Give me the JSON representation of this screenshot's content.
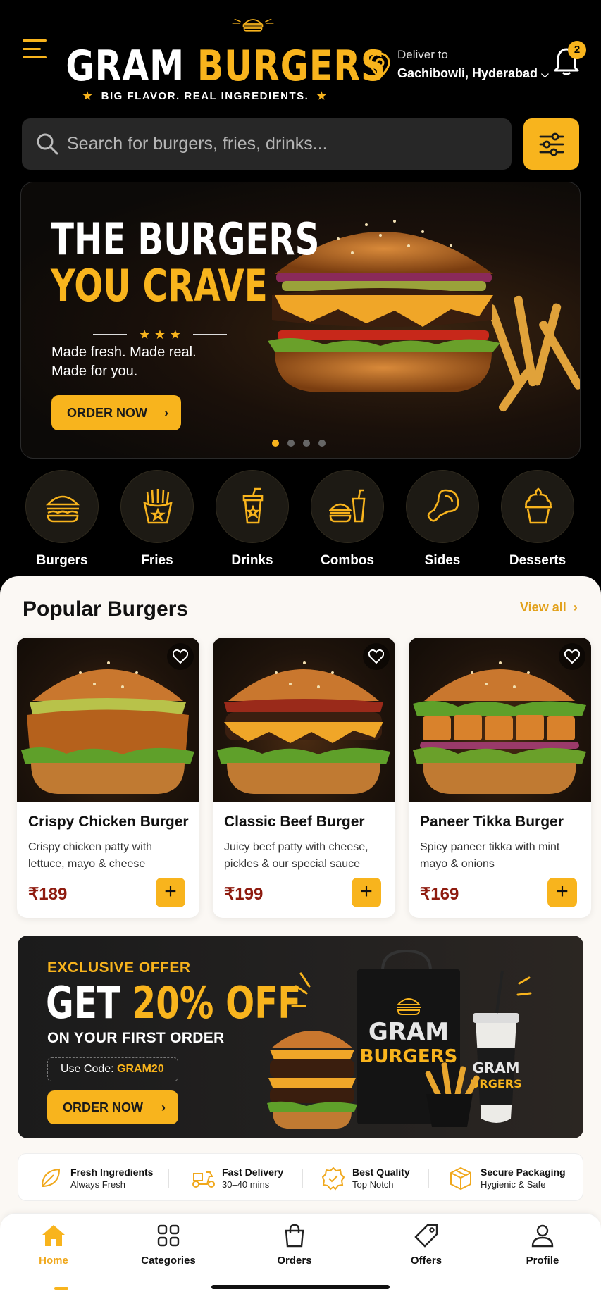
{
  "header": {
    "brand_part1": "GRAM",
    "brand_part2": "BURGERS",
    "tagline": "BIG FLAVOR. REAL INGREDIENTS.",
    "deliver_label": "Deliver to",
    "location": "Gachibowli, Hyderabad",
    "notification_count": "2"
  },
  "search": {
    "placeholder": "Search for burgers, fries, drinks..."
  },
  "hero": {
    "line1": "THE BURGERS",
    "line2": "YOU CRAVE",
    "subtitle_line1": "Made fresh. Made real.",
    "subtitle_line2": "Made for you.",
    "button": "ORDER NOW",
    "slides": 4,
    "active_slide": 1
  },
  "categories": [
    {
      "label": "Burgers",
      "icon": "burger-icon"
    },
    {
      "label": "Fries",
      "icon": "fries-icon"
    },
    {
      "label": "Drinks",
      "icon": "drink-icon"
    },
    {
      "label": "Combos",
      "icon": "combo-icon"
    },
    {
      "label": "Sides",
      "icon": "drumstick-icon"
    },
    {
      "label": "Desserts",
      "icon": "ice-cream-icon"
    }
  ],
  "popular": {
    "title": "Popular Burgers",
    "view_all": "View all",
    "items": [
      {
        "name": "Crispy Chicken Burger",
        "desc": "Crispy chicken patty with lettuce, mayo & cheese",
        "price": "₹189"
      },
      {
        "name": "Classic Beef Burger",
        "desc": "Juicy beef patty with cheese, pickles & our special sauce",
        "price": "₹199"
      },
      {
        "name": "Paneer Tikka Burger",
        "desc": "Spicy paneer tikka with mint mayo & onions",
        "price": "₹169"
      }
    ]
  },
  "offer": {
    "kicker": "EXCLUSIVE OFFER",
    "headline_white": "GET ",
    "headline_yellow": "20% OFF",
    "subline": "ON YOUR FIRST ORDER",
    "code_label": "Use Code: ",
    "code": "GRAM20",
    "button": "ORDER NOW",
    "bag_text1": "GRAM",
    "bag_text2": "BURGERS",
    "cup_text1": "GRAM",
    "cup_text2": "URGERS"
  },
  "features": [
    {
      "title": "Fresh Ingredients",
      "sub": "Always Fresh",
      "icon": "leaf-icon"
    },
    {
      "title": "Fast Delivery",
      "sub": "30–40 mins",
      "icon": "scooter-icon"
    },
    {
      "title": "Best Quality",
      "sub": "Top Notch",
      "icon": "quality-badge-icon"
    },
    {
      "title": "Secure Packaging",
      "sub": "Hygienic & Safe",
      "icon": "box-icon"
    }
  ],
  "nav": [
    {
      "label": "Home",
      "icon": "home-icon",
      "active": true
    },
    {
      "label": "Categories",
      "icon": "grid-icon"
    },
    {
      "label": "Orders",
      "icon": "bag-icon"
    },
    {
      "label": "Offers",
      "icon": "tag-icon"
    },
    {
      "label": "Profile",
      "icon": "user-icon"
    }
  ],
  "colors": {
    "accent": "#f8b41d",
    "price": "#8e1b0f",
    "background": "#000000",
    "panel": "#fbf8f4"
  }
}
